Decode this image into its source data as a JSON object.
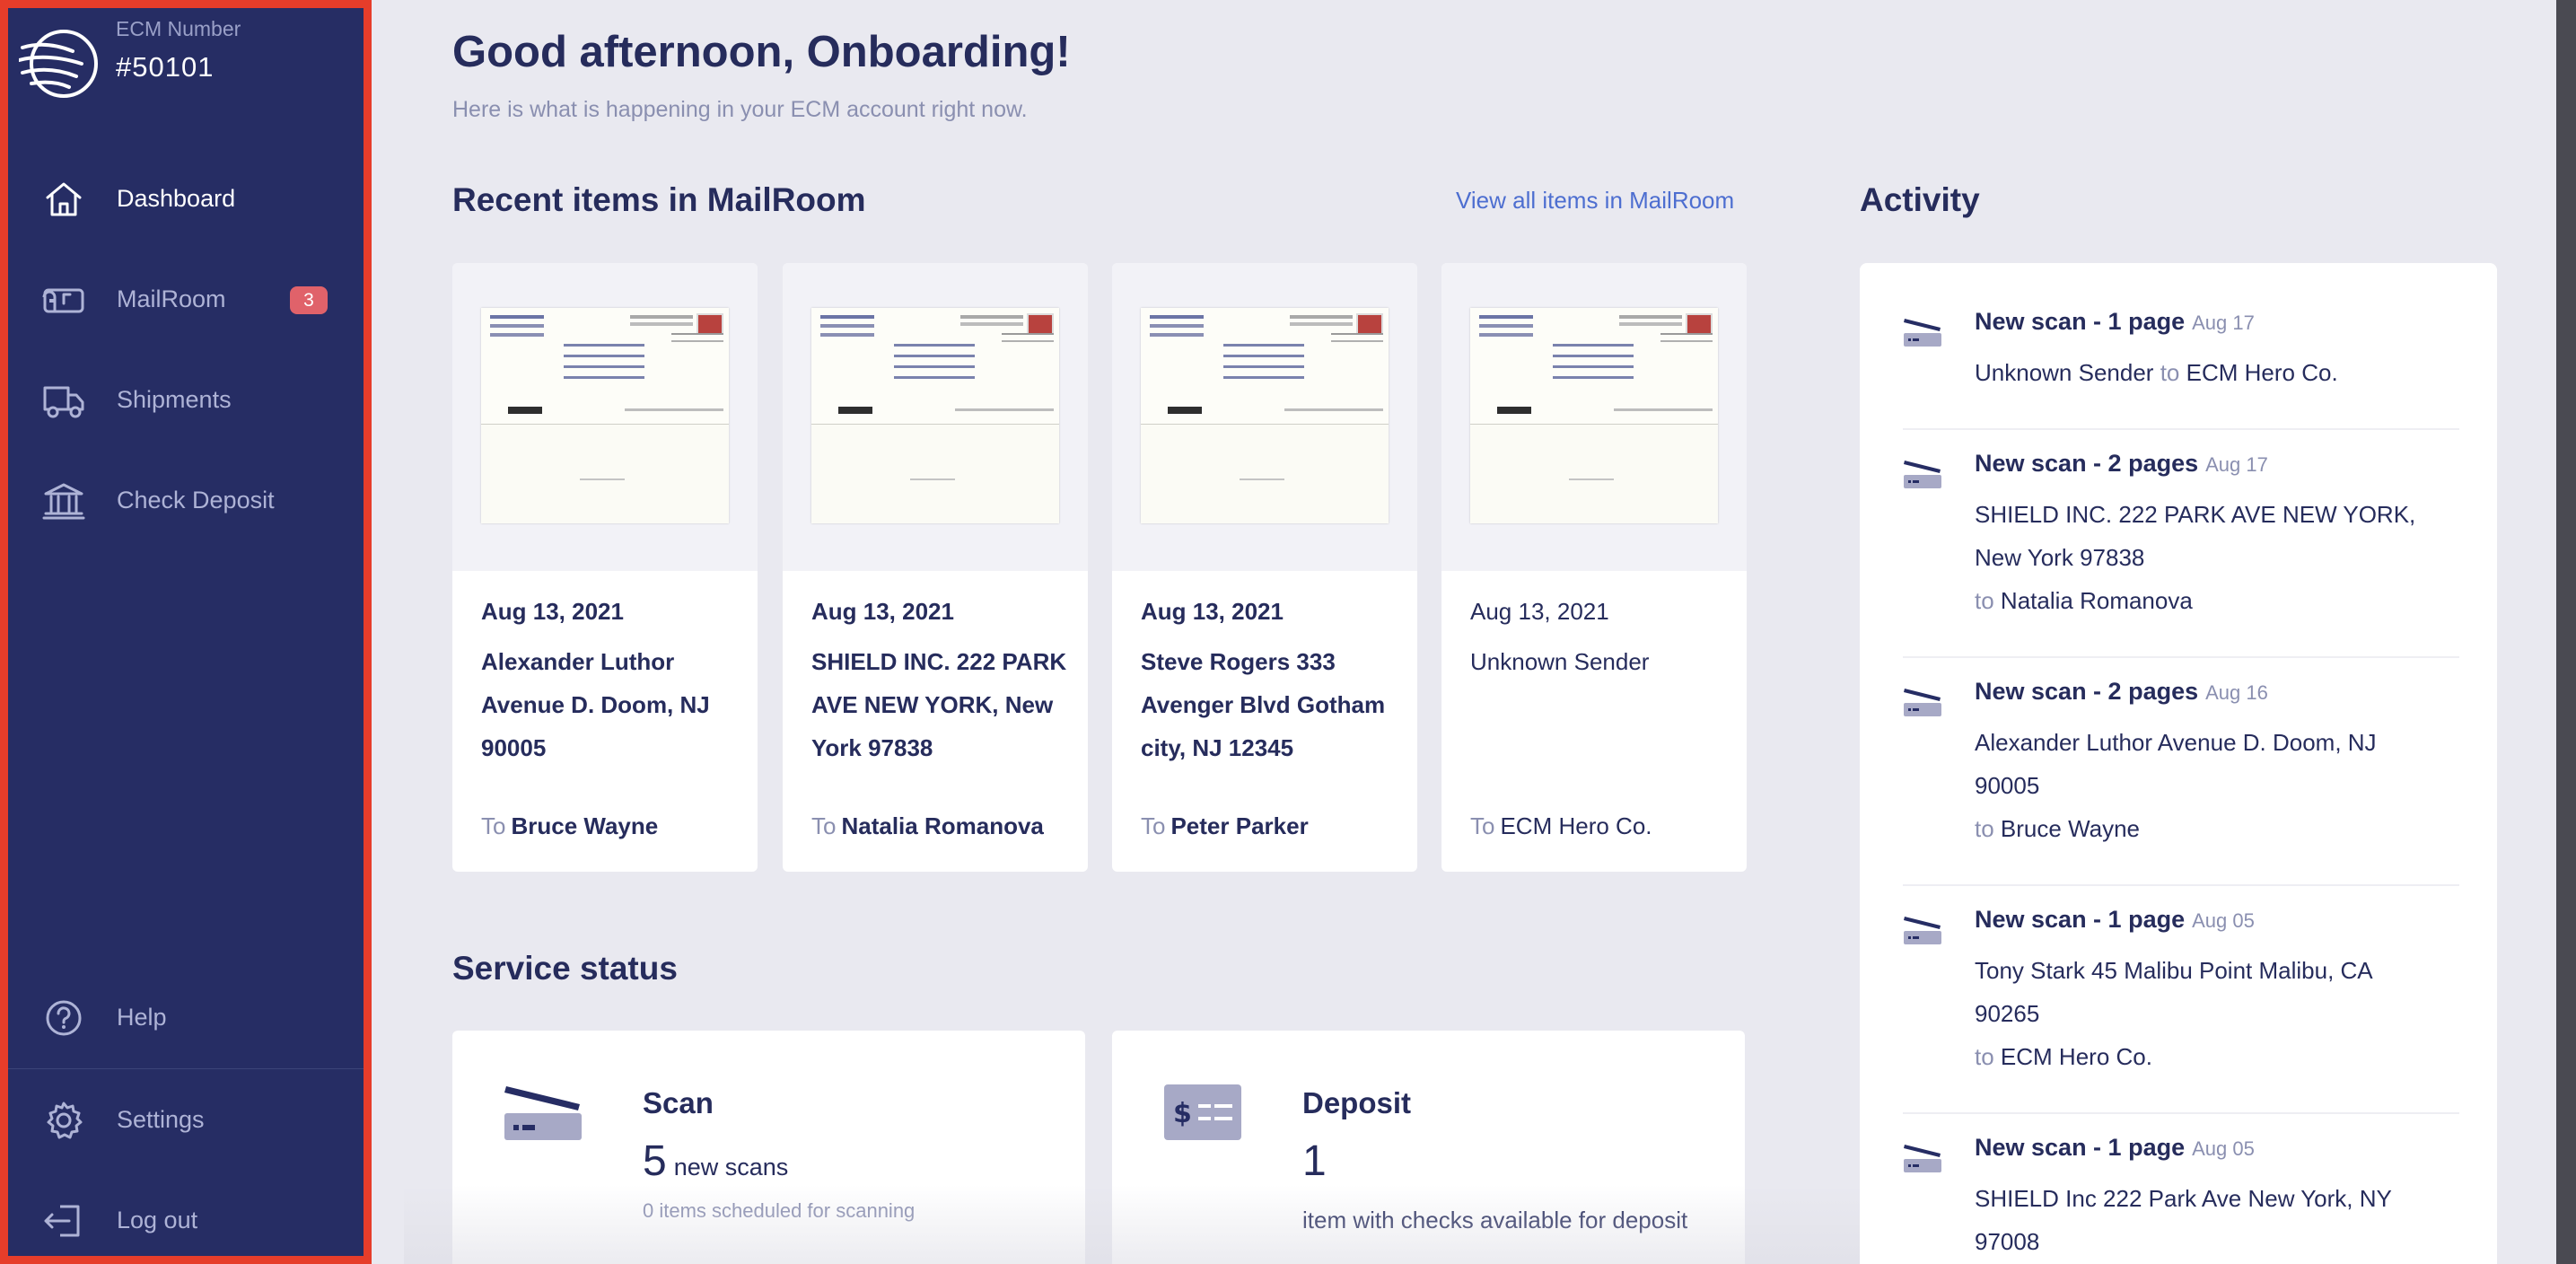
{
  "sidebar": {
    "ecm_label": "ECM Number",
    "ecm_number": "#50101",
    "nav": [
      {
        "label": "Dashboard",
        "icon": "home-icon",
        "active": true
      },
      {
        "label": "MailRoom",
        "icon": "mailbox-icon",
        "badge": "3"
      },
      {
        "label": "Shipments",
        "icon": "truck-icon"
      },
      {
        "label": "Check Deposit",
        "icon": "bank-icon"
      }
    ],
    "bottom_nav": [
      {
        "label": "Help",
        "icon": "help-icon"
      },
      {
        "label": "Settings",
        "icon": "gear-icon"
      },
      {
        "label": "Log out",
        "icon": "logout-icon"
      }
    ]
  },
  "header": {
    "greeting": "Good afternoon, Onboarding!",
    "subtitle": "Here is what is happening in your ECM account right now."
  },
  "recent": {
    "title": "Recent items in MailRoom",
    "view_all": "View all items in MailRoom",
    "items": [
      {
        "date": "Aug 13, 2021",
        "sender": "Alexander Luthor Avenue D. Doom, NJ 90005",
        "to_prefix": "To",
        "to": "Bruce Wayne"
      },
      {
        "date": "Aug 13, 2021",
        "sender": "SHIELD INC. 222 PARK AVE NEW YORK, New York 97838",
        "to_prefix": "To",
        "to": "Natalia Romanova"
      },
      {
        "date": "Aug 13, 2021",
        "sender": "Steve Rogers 333 Avenger Blvd Gotham city, NJ 12345",
        "to_prefix": "To",
        "to": "Peter Parker"
      },
      {
        "date": "Aug 13, 2021",
        "sender": "Unknown Sender",
        "to_prefix": "To",
        "to": "ECM Hero Co."
      }
    ]
  },
  "service": {
    "title": "Service status",
    "scan": {
      "title": "Scan",
      "count": "5",
      "unit": "new scans",
      "note": "0 items scheduled for scanning"
    },
    "deposit": {
      "title": "Deposit",
      "count": "1",
      "desc": "item with checks available for deposit"
    }
  },
  "activity": {
    "title": "Activity",
    "items": [
      {
        "title": "New scan - 1 page",
        "date": "Aug 17",
        "from": "Unknown Sender",
        "to_word": "to",
        "to": "ECM Hero Co."
      },
      {
        "title": "New scan - 2 pages",
        "date": "Aug 17",
        "from": "SHIELD INC. 222 PARK AVE NEW YORK, New York 97838",
        "to_word": "to",
        "to": "Natalia Romanova"
      },
      {
        "title": "New scan - 2 pages",
        "date": "Aug 16",
        "from": "Alexander Luthor Avenue D. Doom, NJ 90005",
        "to_word": "to",
        "to": "Bruce Wayne"
      },
      {
        "title": "New scan - 1 page",
        "date": "Aug 05",
        "from": "Tony Stark 45 Malibu Point Malibu, CA 90265",
        "to_word": "to",
        "to": "ECM Hero Co."
      },
      {
        "title": "New scan - 1 page",
        "date": "Aug 05",
        "from": "SHIELD Inc 222 Park Ave New York, NY 97008",
        "to_word": "",
        "to": ""
      }
    ]
  },
  "colors": {
    "sidebar_bg": "#262d64",
    "sidebar_border": "#e63d2a",
    "accent_link": "#4d6ed0",
    "badge": "#e0626a",
    "text_primary": "#262c5c",
    "text_muted": "#8a8fb0"
  }
}
